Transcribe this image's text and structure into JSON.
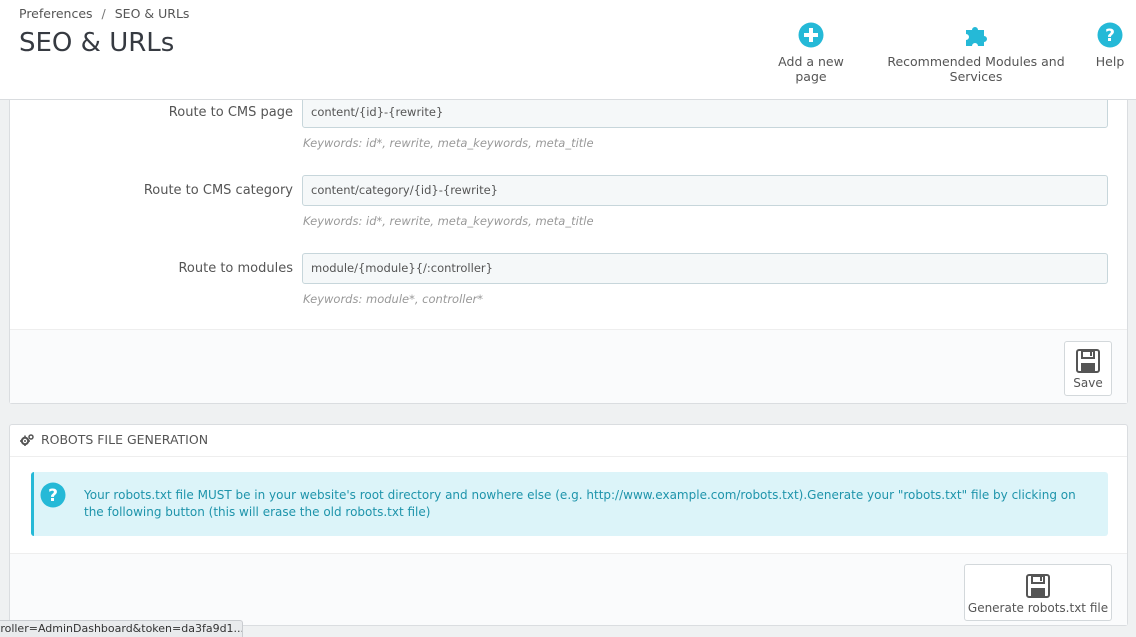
{
  "breadcrumb": {
    "parent": "Preferences",
    "separator": "/",
    "current": "SEO & URLs"
  },
  "page": {
    "title": "SEO & URLs"
  },
  "toolbar": {
    "add_new_page": "Add a new page",
    "recommended_modules": "Recommended Modules and Services",
    "help": "Help"
  },
  "routes": [
    {
      "label": "Route to CMS page",
      "value": "content/{id}-{rewrite}",
      "help": "Keywords: id*, rewrite, meta_keywords, meta_title"
    },
    {
      "label": "Route to CMS category",
      "value": "content/category/{id}-{rewrite}",
      "help": "Keywords: id*, rewrite, meta_keywords, meta_title"
    },
    {
      "label": "Route to modules",
      "value": "module/{module}{/:controller}",
      "help": "Keywords: module*, controller*"
    }
  ],
  "save_label": "Save",
  "robots": {
    "heading": "ROBOTS FILE GENERATION",
    "info": "Your robots.txt file MUST be in your website's root directory and nowhere else (e.g. http://www.example.com/robots.txt).Generate your \"robots.txt\" file by clicking on the following button (this will erase the old robots.txt file)",
    "generate_label": "Generate robots.txt file"
  },
  "status_bar": {
    "url": "troller=AdminDashboard&token=da3fa9d1..."
  },
  "colors": {
    "accent": "#25b9d7",
    "info_bg": "#dcf4f9",
    "info_text": "#1e94ab"
  }
}
